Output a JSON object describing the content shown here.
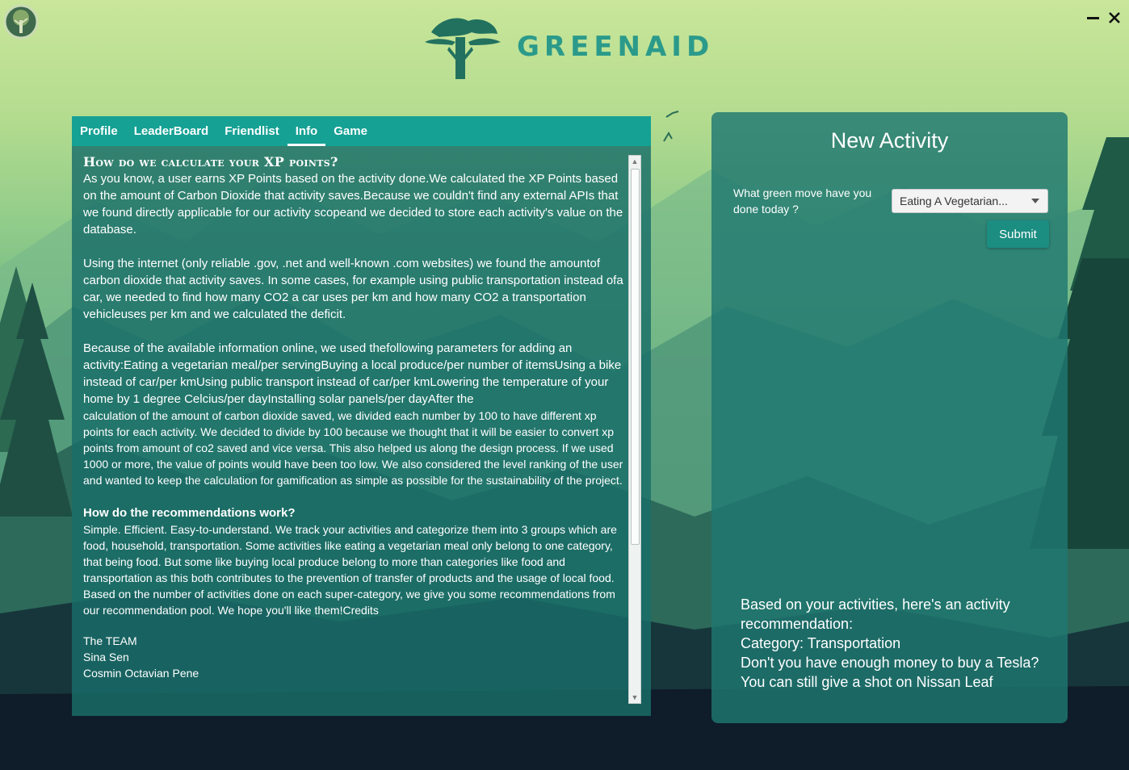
{
  "app": {
    "logo_text": "GREENAID",
    "icons": {
      "app": "tree-icon",
      "minimize": "minimize-icon",
      "close": "close-icon"
    }
  },
  "tabs": [
    {
      "label": "Profile",
      "active": false
    },
    {
      "label": "LeaderBoard",
      "active": false
    },
    {
      "label": "Friendlist",
      "active": false
    },
    {
      "label": "Info",
      "active": true
    },
    {
      "label": "Game",
      "active": false
    }
  ],
  "info": {
    "heading": "How do we calculate your XP points?",
    "para1": "As you know, a user earns XP Points based on the activity done.We calculated the XP Points based on the amount of Carbon Dioxide that activity saves.Because we couldn't find any external APIs that we found directly applicable for our activity scopeand we decided to store each activity's value on the database.",
    "para2": "Using the internet (only reliable .gov, .net and well-known .com websites) we found the amountof carbon dioxide that activity saves. In some cases, for example using public transportation instead ofa car, we needed to find how many CO2 a car uses per km and how many CO2 a transportation vehicleuses per km and we calculated the deficit.",
    "para3a": "Because of the available information online, we used thefollowing parameters for adding an activity:Eating a vegetarian meal/per servingBuying a local produce/per number of itemsUsing a bike instead of car/per kmUsing public transport instead of car/per kmLowering the temperature of your home by 1 degree Celcius/per dayInstalling solar panels/per dayAfter the",
    "para3b": "calculation of the amount of carbon dioxide saved, we divided each number by 100 to have different xp points for each activity. We decided to divide by 100 because we thought that it will be easier to convert xp points from amount of co2 saved and vice versa. This also helped us along the design process.  If we used 1000 or more, the value of points would have been too low. We also considered the level ranking of the user and wanted to keep the calculation for gamification as simple as possible for the sustainability of the project.",
    "rec_heading": "How do the recommendations work?",
    "rec_body": "Simple. Efficient. Easy-to-understand. We track your activities and categorize them into 3 groups which are food, household, transportation. Some activities like eating a vegetarian meal only belong to one category, that being food. But some like buying local produce belong to more than categories like food and transportation as this both contributes to the prevention of transfer of products and the usage of local food. Based on the number of activities done on each super-category, we give you some recommendations from our recommendation pool. We hope you'll like them!Credits",
    "credits": [
      "The TEAM",
      "Sina Sen",
      "Cosmin Octavian Pene"
    ]
  },
  "new_activity": {
    "title": "New Activity",
    "question": "What green move have you done today ?",
    "selected": "Eating A Vegetarian...",
    "submit_label": "Submit",
    "recommendation_lines": [
      "Based on your activities, here's an activity",
      "recommendation:",
      "Category: Transportation",
      "Don't you have enough money to buy a Tesla?",
      "You can still give a shot on Nissan Leaf"
    ]
  }
}
